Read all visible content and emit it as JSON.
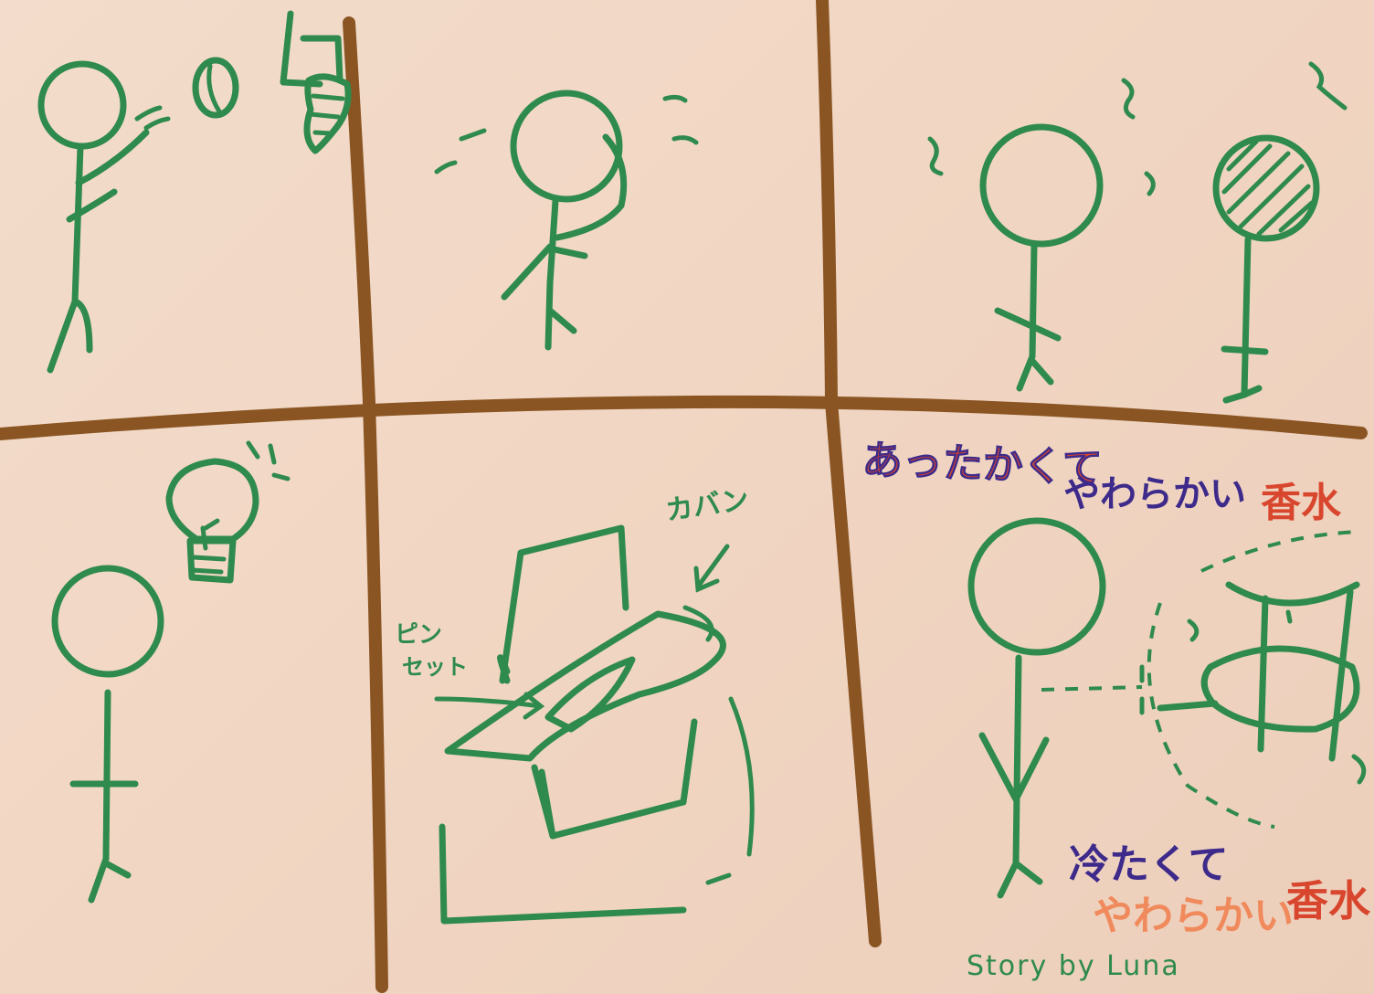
{
  "panel3": {
    "line1": "あったかくて",
    "line2_soft": "やわらかい",
    "line2_perfume": "香水",
    "line3": "冷たくて",
    "line4_soft": "やわらかい",
    "line4_perfume": "香水"
  },
  "panel5": {
    "label_bag": "カバン",
    "label_tweezers_1": "ピン",
    "label_tweezers_2": "セット"
  },
  "signature": "Story by Luna",
  "colors": {
    "paper": "#f1d6c3",
    "ink_green": "#2f8a4e",
    "ink_brown": "#8a5523",
    "ink_purple": "#3d2a8a",
    "ink_red": "#d9462e"
  }
}
